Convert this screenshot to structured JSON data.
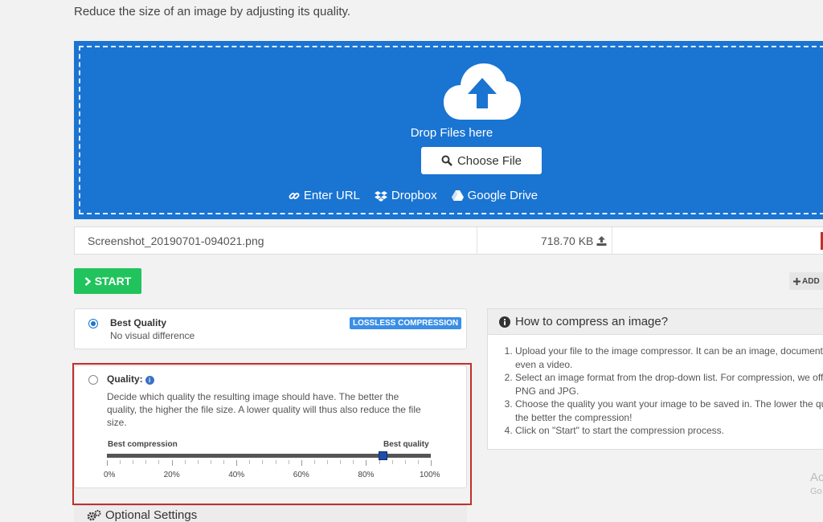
{
  "intro": "Reduce the size of an image by adjusting its quality.",
  "dropzone": {
    "drop_text": "Drop Files here",
    "choose_label": "Choose File",
    "sources": [
      {
        "icon": "link-icon",
        "label": "Enter URL"
      },
      {
        "icon": "dropbox-icon",
        "label": "Dropbox"
      },
      {
        "icon": "google-drive-icon",
        "label": "Google Drive"
      }
    ]
  },
  "file": {
    "name": "Screenshot_20190701-094021.png",
    "size": "718.70 KB"
  },
  "actions": {
    "start_label": "START",
    "add_label": "ADD"
  },
  "options": {
    "best": {
      "title": "Best Quality",
      "subtitle": "No visual difference",
      "badge": "LOSSLESS COMPRESSION",
      "selected": true
    },
    "quality": {
      "title": "Quality:",
      "description": "Decide which quality the resulting image should have. The better the quality, the higher the file size. A lower quality will thus also reduce the file size.",
      "left_label": "Best compression",
      "right_label": "Best quality",
      "value_percent": 85,
      "ticks": [
        "0%",
        "20%",
        "40%",
        "60%",
        "80%",
        "100%"
      ],
      "selected": false
    }
  },
  "optional_settings": "Optional Settings",
  "howto": {
    "title": "How to compress an image?",
    "steps": [
      "Upload your file to the image compressor. It can be an image, document or even a video.",
      "Select an image format from the drop-down list. For compression, we offer PNG and JPG.",
      "Choose the quality you want your image to be saved in. The lower the quality, the better the compression!",
      "Click on \"Start\" to start the compression process."
    ]
  },
  "watermark": {
    "line1": "Ac",
    "line2": "Go"
  },
  "colors": {
    "accent": "#1a74d2",
    "start": "#21c35d",
    "highlight": "#c0302b"
  }
}
